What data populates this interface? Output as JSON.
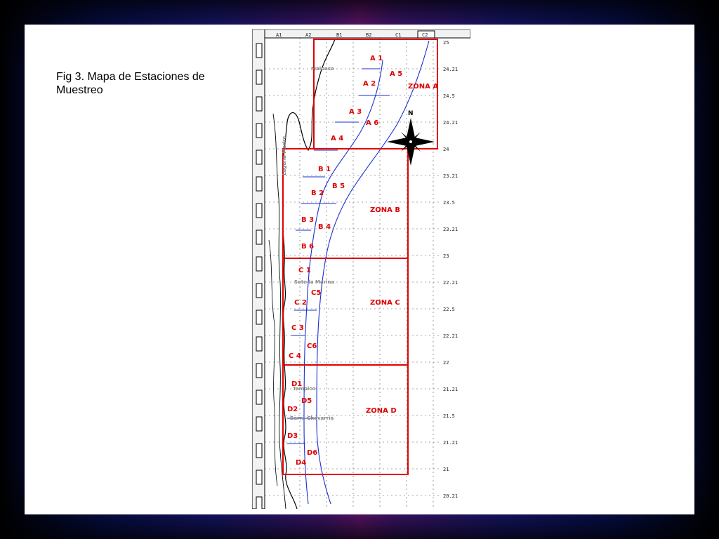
{
  "caption": {
    "line1": "Fig 3. Mapa de Estaciones de",
    "line2": "Muestreo"
  },
  "colors": {
    "zone_border": "#e00000",
    "transect": "#1a2fd0",
    "label": "#e00000",
    "coast": "#000000"
  },
  "map": {
    "top_columns": [
      "A1",
      "A2",
      "B1",
      "B2",
      "C1",
      "C2"
    ],
    "zones": [
      {
        "name": "ZONA A"
      },
      {
        "name": "ZONA B"
      },
      {
        "name": "ZONA C"
      },
      {
        "name": "ZONA D"
      }
    ],
    "stations": [
      "A 1",
      "A 2",
      "A 3",
      "A 4",
      "A 5",
      "A 6",
      "B 1",
      "B 2",
      "B 3",
      "B 4",
      "B 5",
      "B 6",
      "C 1",
      "C 2",
      "C 3",
      "C 4",
      "C5",
      "C6",
      "D1",
      "D2",
      "D3",
      "D4",
      "D5",
      "D6"
    ],
    "compass_label": "N",
    "places": [
      "Malpaso",
      "Laguna Madre",
      "Soto la Marina",
      "Tampico",
      "Barra Chavarría"
    ],
    "right_ticks": [
      "25",
      "24.21",
      "24.5",
      "24.21",
      "24",
      "23.21",
      "23.5",
      "23.21",
      "23",
      "22.21",
      "22.5",
      "22.21",
      "22",
      "21.21",
      "21.5",
      "21.21",
      "21",
      "20.21"
    ]
  }
}
